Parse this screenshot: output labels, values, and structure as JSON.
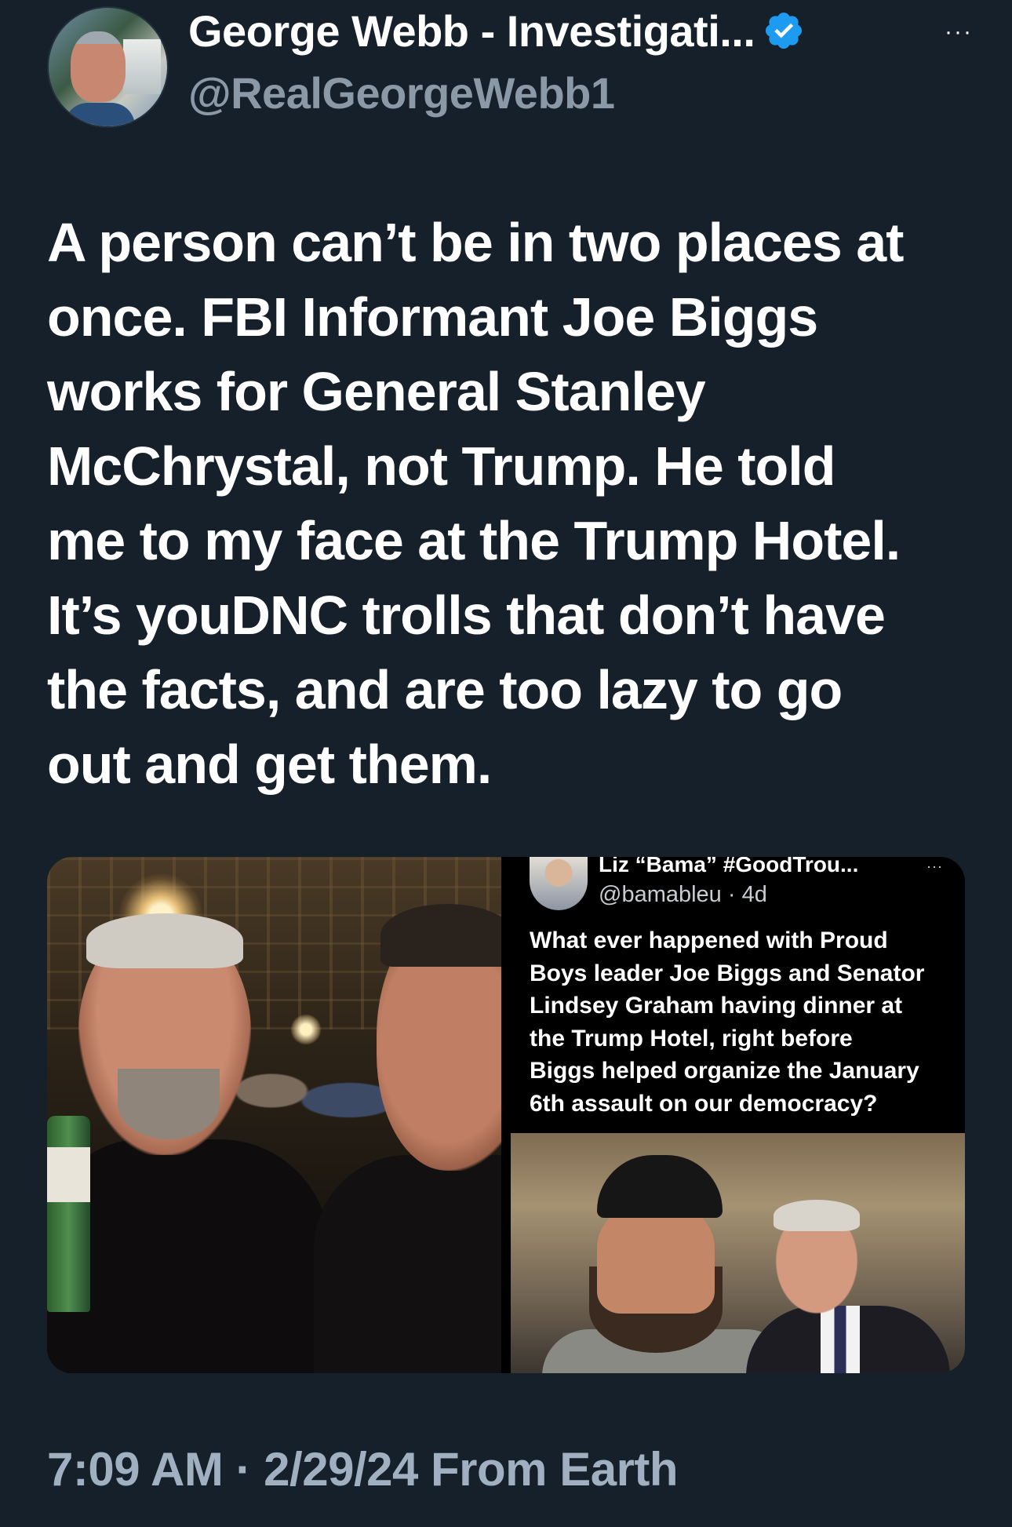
{
  "author": {
    "display_name": "George Webb - Investigati...",
    "handle": "@RealGeorgeWebb1",
    "verified": true,
    "verified_badge_color": "#1d9bf0"
  },
  "more_menu_label": "···",
  "tweet": {
    "text": "A person can’t be in two places at\nonce. FBI Informant Joe Biggs\nworks for General Stanley\nMcChrystal, not Trump.  He told\nme to my face at the Trump Hotel.\nIt’s youDNC trolls that don’t have\nthe facts, and are too lazy to go\nout and get them.",
    "timestamp": "7:09 AM · 2/29/24 From Earth"
  },
  "media": {
    "quoted_screenshot": {
      "display_name": "Liz “Bama” #GoodTrou...",
      "handle": "@bamableu · 4d",
      "more_label": "···",
      "text": "What ever happened with Proud\nBoys leader Joe Biggs and Senator\nLindsey Graham having dinner at\nthe Trump Hotel, right before\nBiggs helped organize the January\n6th assault on our democracy?"
    }
  },
  "colors": {
    "background": "#15202b",
    "text_primary": "#ffffff",
    "text_secondary": "#8b98a5",
    "timestamp": "#a0b0c0"
  }
}
